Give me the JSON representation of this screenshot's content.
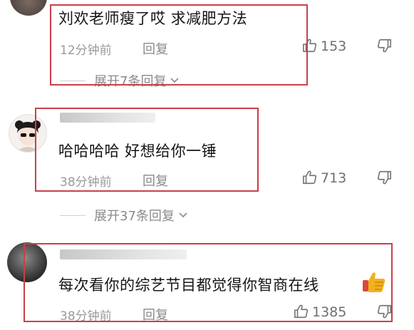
{
  "comments": [
    {
      "text": "刘欢老师瘦了哎 求减肥方法",
      "time": "12分钟前",
      "reply_label": "回复",
      "likes": "153",
      "expand": "展开7条回复"
    },
    {
      "text": "哈哈哈哈 好想给你一锤",
      "time": "38分钟前",
      "reply_label": "回复",
      "likes": "713",
      "expand": "展开37条回复"
    },
    {
      "text": "每次看你的综艺节目都觉得你智商在线",
      "time": "38分钟前",
      "reply_label": "回复",
      "likes": "1385"
    }
  ],
  "colors": {
    "highlight": "#c8404a",
    "meta_text": "#9a9a9a",
    "thumb_emoji": "#f2b11c"
  },
  "icons": [
    "thumbs-up-icon",
    "thumbs-down-icon",
    "chevron-down-icon",
    "thumbs-up-emoji"
  ]
}
